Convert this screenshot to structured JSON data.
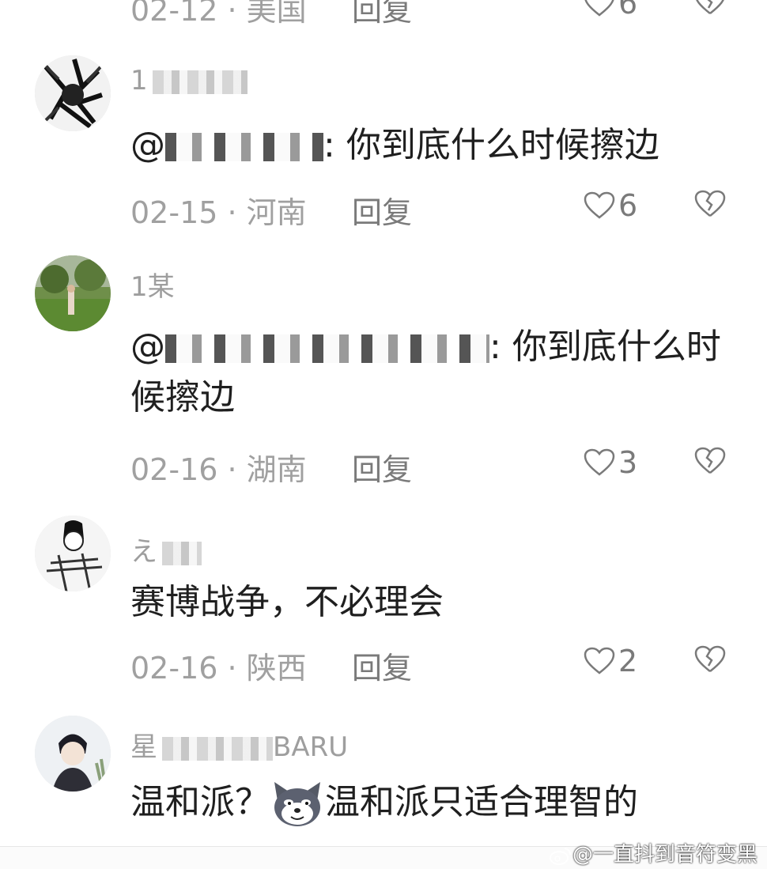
{
  "top_partial": {
    "date": "02-12 · 美国",
    "reply": "回复",
    "likes": "6"
  },
  "comments": [
    {
      "username_visible": "1",
      "mention_prefix": "@",
      "mention_suffix": ":",
      "text": "你到底什么时候擦边",
      "date": "02-15 · 河南",
      "reply": "回复",
      "likes": "6"
    },
    {
      "username_visible": "1某",
      "mention_prefix": "@",
      "mention_suffix": ":",
      "text": "你到底什么时候擦边",
      "date": "02-16 · 湖南",
      "reply": "回复",
      "likes": "3"
    },
    {
      "username_visible": "え",
      "text": "赛博战争，不必理会",
      "date": "02-16 · 陕西",
      "reply": "回复",
      "likes": "2"
    },
    {
      "username_visible": "星",
      "username_suffix": "BARU",
      "text_before_emoji": "温和派？",
      "text_after_emoji": "温和派只适合理智的"
    }
  ],
  "watermark": {
    "text": "@一直抖到音符变黑"
  },
  "colors": {
    "text": "#1f1f1f",
    "meta": "#a0a0a0",
    "icon": "#7a7a7a"
  }
}
